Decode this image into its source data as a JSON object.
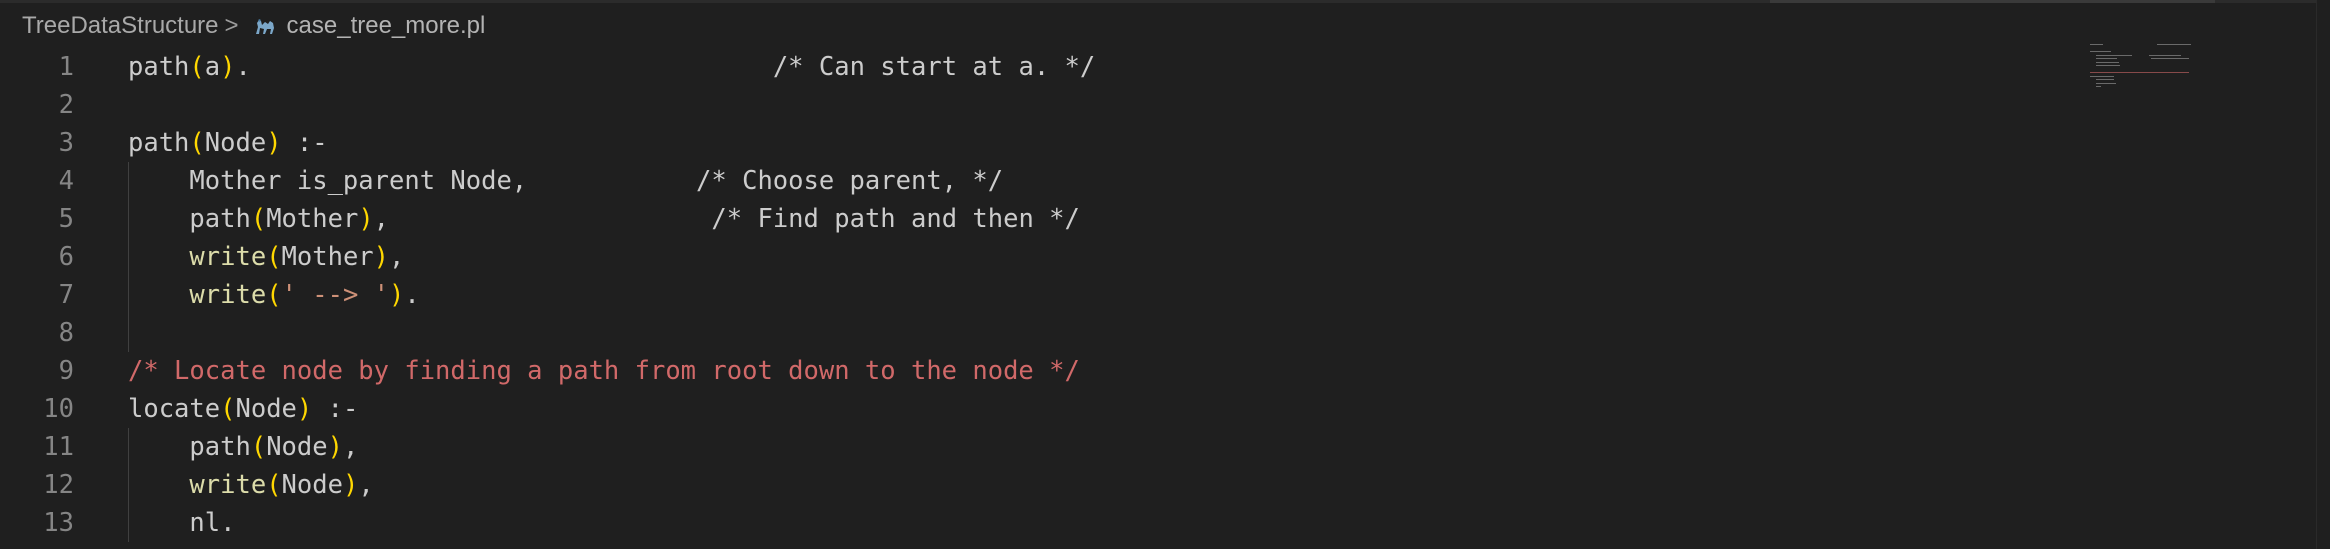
{
  "breadcrumb": {
    "folder": "TreeDataStructure",
    "separator": ">",
    "file_icon": "camel-icon",
    "file": "case_tree_more.pl"
  },
  "colors": {
    "background": "#1f1f1f",
    "line_number": "#858585",
    "default_text": "#cccccc",
    "bracket": "#ffd700",
    "function": "#dcdcaa",
    "string": "#ce9178",
    "comment_highlight": "#d16969"
  },
  "code_lines": [
    {
      "number": "1",
      "tokens": [
        {
          "text": "path",
          "kind": "plain"
        },
        {
          "text": "(",
          "kind": "paren"
        },
        {
          "text": "a",
          "kind": "plain"
        },
        {
          "text": ")",
          "kind": "paren"
        },
        {
          "text": ".                                  /* Can start at a. */",
          "kind": "plain"
        }
      ]
    },
    {
      "number": "2",
      "tokens": []
    },
    {
      "number": "3",
      "tokens": [
        {
          "text": "path",
          "kind": "plain"
        },
        {
          "text": "(",
          "kind": "paren"
        },
        {
          "text": "Node",
          "kind": "plain"
        },
        {
          "text": ")",
          "kind": "paren"
        },
        {
          "text": " :-",
          "kind": "plain"
        }
      ]
    },
    {
      "number": "4",
      "tokens": [
        {
          "text": "    Mother is_parent Node,           /* Choose parent, */",
          "kind": "plain"
        }
      ]
    },
    {
      "number": "5",
      "tokens": [
        {
          "text": "    path",
          "kind": "plain"
        },
        {
          "text": "(",
          "kind": "paren"
        },
        {
          "text": "Mother",
          "kind": "plain"
        },
        {
          "text": ")",
          "kind": "paren"
        },
        {
          "text": ",                     /* Find path and then */",
          "kind": "plain"
        }
      ]
    },
    {
      "number": "6",
      "tokens": [
        {
          "text": "    ",
          "kind": "plain"
        },
        {
          "text": "write",
          "kind": "fn"
        },
        {
          "text": "(",
          "kind": "paren"
        },
        {
          "text": "Mother",
          "kind": "plain"
        },
        {
          "text": ")",
          "kind": "paren"
        },
        {
          "text": ",",
          "kind": "plain"
        }
      ]
    },
    {
      "number": "7",
      "tokens": [
        {
          "text": "    ",
          "kind": "plain"
        },
        {
          "text": "write",
          "kind": "fn"
        },
        {
          "text": "(",
          "kind": "paren"
        },
        {
          "text": "' --> '",
          "kind": "str"
        },
        {
          "text": ")",
          "kind": "paren"
        },
        {
          "text": ".",
          "kind": "plain"
        }
      ]
    },
    {
      "number": "8",
      "tokens": []
    },
    {
      "number": "9",
      "tokens": [
        {
          "text": "/* Locate node by finding a path from root down to the node */",
          "kind": "cmt-red"
        }
      ]
    },
    {
      "number": "10",
      "tokens": [
        {
          "text": "locate",
          "kind": "plain"
        },
        {
          "text": "(",
          "kind": "paren"
        },
        {
          "text": "Node",
          "kind": "plain"
        },
        {
          "text": ")",
          "kind": "paren"
        },
        {
          "text": " :-",
          "kind": "plain"
        }
      ]
    },
    {
      "number": "11",
      "tokens": [
        {
          "text": "    path",
          "kind": "plain"
        },
        {
          "text": "(",
          "kind": "paren"
        },
        {
          "text": "Node",
          "kind": "plain"
        },
        {
          "text": ")",
          "kind": "paren"
        },
        {
          "text": ",",
          "kind": "plain"
        }
      ]
    },
    {
      "number": "12",
      "tokens": [
        {
          "text": "    ",
          "kind": "plain"
        },
        {
          "text": "write",
          "kind": "fn"
        },
        {
          "text": "(",
          "kind": "paren"
        },
        {
          "text": "Node",
          "kind": "plain"
        },
        {
          "text": ")",
          "kind": "paren"
        },
        {
          "text": ",",
          "kind": "plain"
        }
      ]
    },
    {
      "number": "13",
      "tokens": [
        {
          "text": "    nl.",
          "kind": "plain"
        }
      ]
    }
  ]
}
